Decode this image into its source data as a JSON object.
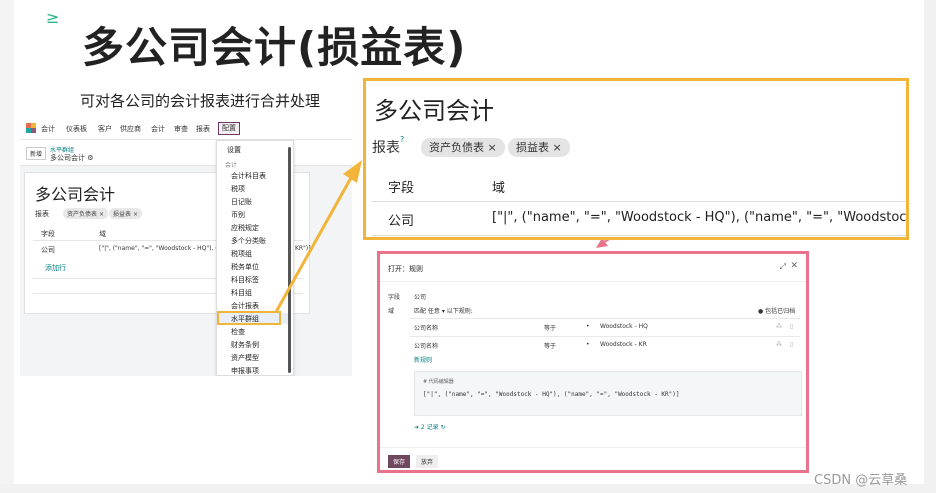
{
  "slide": {
    "title": "多公司会计(损益表)",
    "subtitle": "可对各公司的会计报表进行合并处理",
    "watermark": "CSDN @云草桑"
  },
  "left_screenshot": {
    "nav": {
      "app_name": "会计",
      "items": [
        "仪表板",
        "客户",
        "供应商",
        "会计",
        "审查",
        "报表",
        "配置"
      ],
      "active": "配置"
    },
    "buttons": {
      "new": "新增"
    },
    "breadcrumb": {
      "parent": "水平群组",
      "current": "多公司会计"
    },
    "card": {
      "title": "多公司会计",
      "report_label": "报表",
      "tags": [
        "资产负债表",
        "损益表"
      ],
      "columns": [
        "字段",
        "域"
      ],
      "row": {
        "field": "公司",
        "domain_visible": "[\"|\", (\"name\", \"=\", \"Woodstock - HQ\"), (\"n",
        "domain_tail": "KR\")]"
      },
      "add_line": "添加行"
    },
    "config_menu": {
      "top_item": "设置",
      "section": "会计",
      "items": [
        "会计科目表",
        "税项",
        "日记账",
        "币别",
        "应税规定",
        "多个分类账",
        "税项组",
        "税务单位",
        "科目标签",
        "科目组",
        "会计报表",
        "水平群组",
        "检查",
        "财务条例",
        "资产模型",
        "申报事项"
      ],
      "active": "水平群组"
    }
  },
  "zoom_box": {
    "title": "多公司会计",
    "report_label": "报表",
    "report_help": "?",
    "tags": [
      "资产负债表",
      "损益表"
    ],
    "tag_remove": "×",
    "columns": [
      "字段",
      "域"
    ],
    "row": {
      "field": "公司",
      "domain": "[\"|\", (\"name\", \"=\", \"Woodstock - HQ\"), (\"name\", \"=\", \"Woodstock - KR\")]"
    },
    "border_color": "#f2b53a"
  },
  "modal": {
    "title": "打开：规则",
    "field_label": "字段",
    "field_value": "公司",
    "domain_label": "域",
    "match_text": "匹配 任意 ▾ 以下规则:",
    "include_archived": "包括已归档",
    "rules": [
      {
        "field": "公司名称",
        "operator": "等于",
        "value": "Woodstock - HQ"
      },
      {
        "field": "公司名称",
        "operator": "等于",
        "value": "Woodstock - KR"
      }
    ],
    "new_rule": "新规则",
    "code_editor_label": "# 代码编辑器",
    "code_text": "[\"|\", (\"name\", \"=\", \"Woodstock - HQ\"), (\"name\", \"=\", \"Woodstock - KR\")]",
    "records": "➜ 2 记录",
    "save": "保存",
    "discard": "放弃",
    "border_color": "#e8738a"
  },
  "colors": {
    "odoo_brand": "#71495f",
    "link": "#017e84",
    "accent_green": "#2bb58f"
  },
  "icons": [
    "odoo-logo-icon",
    "close-icon",
    "expand-icon",
    "drag-icon",
    "delete-icon",
    "refresh-icon",
    "arrow-icon"
  ]
}
